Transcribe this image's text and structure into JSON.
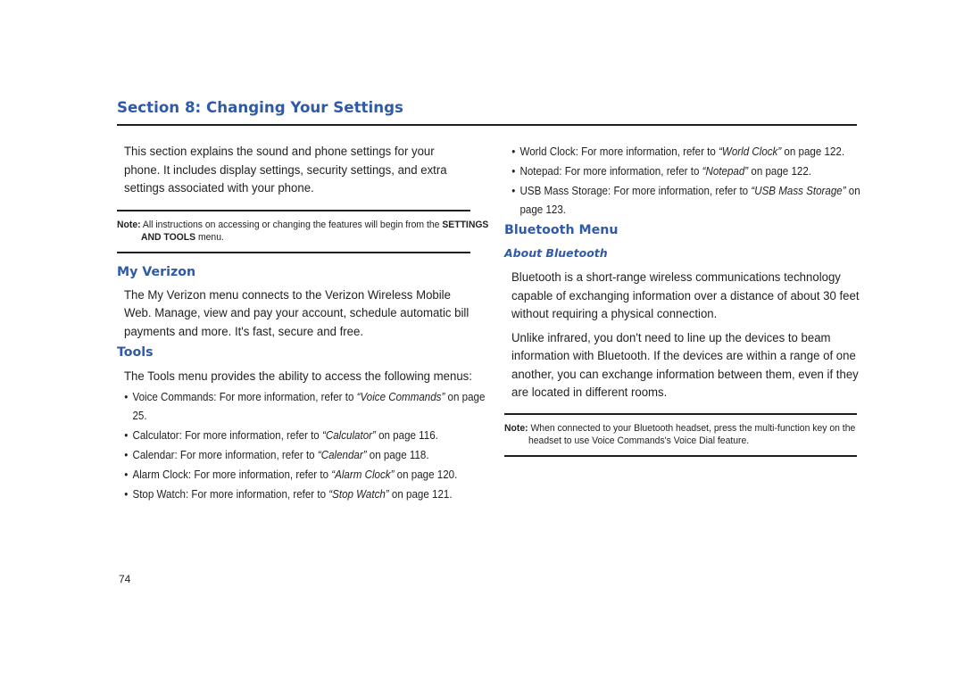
{
  "page": {
    "title": "Section 8: Changing Your Settings",
    "page_number": "74",
    "heading_color": "#2f5aa8"
  },
  "left": {
    "intro": "This section explains the sound and phone settings for your phone. It includes display settings, security settings, and extra settings associated with your phone.",
    "note1": {
      "label": "Note:",
      "text_before": " All instructions on accessing or changing the features will begin from the ",
      "bold": "SETTINGS AND TOOLS",
      "text_after": " menu."
    },
    "my_verizon": {
      "heading": "My Verizon",
      "body": "The My Verizon menu connects to the Verizon Wireless Mobile Web. Manage, view and pay your account, schedule automatic bill payments and more. It's fast, secure and free."
    },
    "tools": {
      "heading": "Tools",
      "body": "The Tools menu provides the ability to access the following menus:",
      "bullets": [
        {
          "prefix": "Voice Commands: For more information, refer to ",
          "ref": "“Voice Commands”",
          "suffix": " on page 25."
        },
        {
          "prefix": "Calculator: For more information, refer to ",
          "ref": "“Calculator”",
          "suffix": " on page 116."
        },
        {
          "prefix": "Calendar: For more information, refer to ",
          "ref": "“Calendar”",
          "suffix": " on page 118."
        },
        {
          "prefix": "Alarm Clock: For more information, refer to ",
          "ref": "“Alarm Clock”",
          "suffix": " on page 120."
        },
        {
          "prefix": "Stop Watch: For more information, refer to ",
          "ref": "“Stop Watch”",
          "suffix": " on page 121."
        }
      ]
    }
  },
  "right": {
    "bullets": [
      {
        "prefix": "World Clock: For more information, refer to ",
        "ref": "“World Clock”",
        "suffix": " on page 122."
      },
      {
        "prefix": "Notepad: For more information, refer to ",
        "ref": "“Notepad”",
        "suffix": " on page 122."
      },
      {
        "prefix": "USB Mass Storage: For more information, refer to ",
        "ref": "“USB Mass Storage”",
        "suffix": " on page 123."
      }
    ],
    "bluetooth": {
      "heading": "Bluetooth Menu",
      "subheading": "About Bluetooth",
      "para1": "Bluetooth is a short-range wireless communications technology capable of exchanging information over a distance of about 30 feet without requiring a physical connection.",
      "para2": "Unlike infrared, you don't need to line up the devices to beam information with Bluetooth. If the devices are within a range of one another, you can exchange information between them, even if they are located in different rooms."
    },
    "note2": {
      "label": "Note:",
      "text": " When connected to your Bluetooth headset, press the multi-function key on the headset to use Voice Commands's Voice Dial feature."
    }
  }
}
